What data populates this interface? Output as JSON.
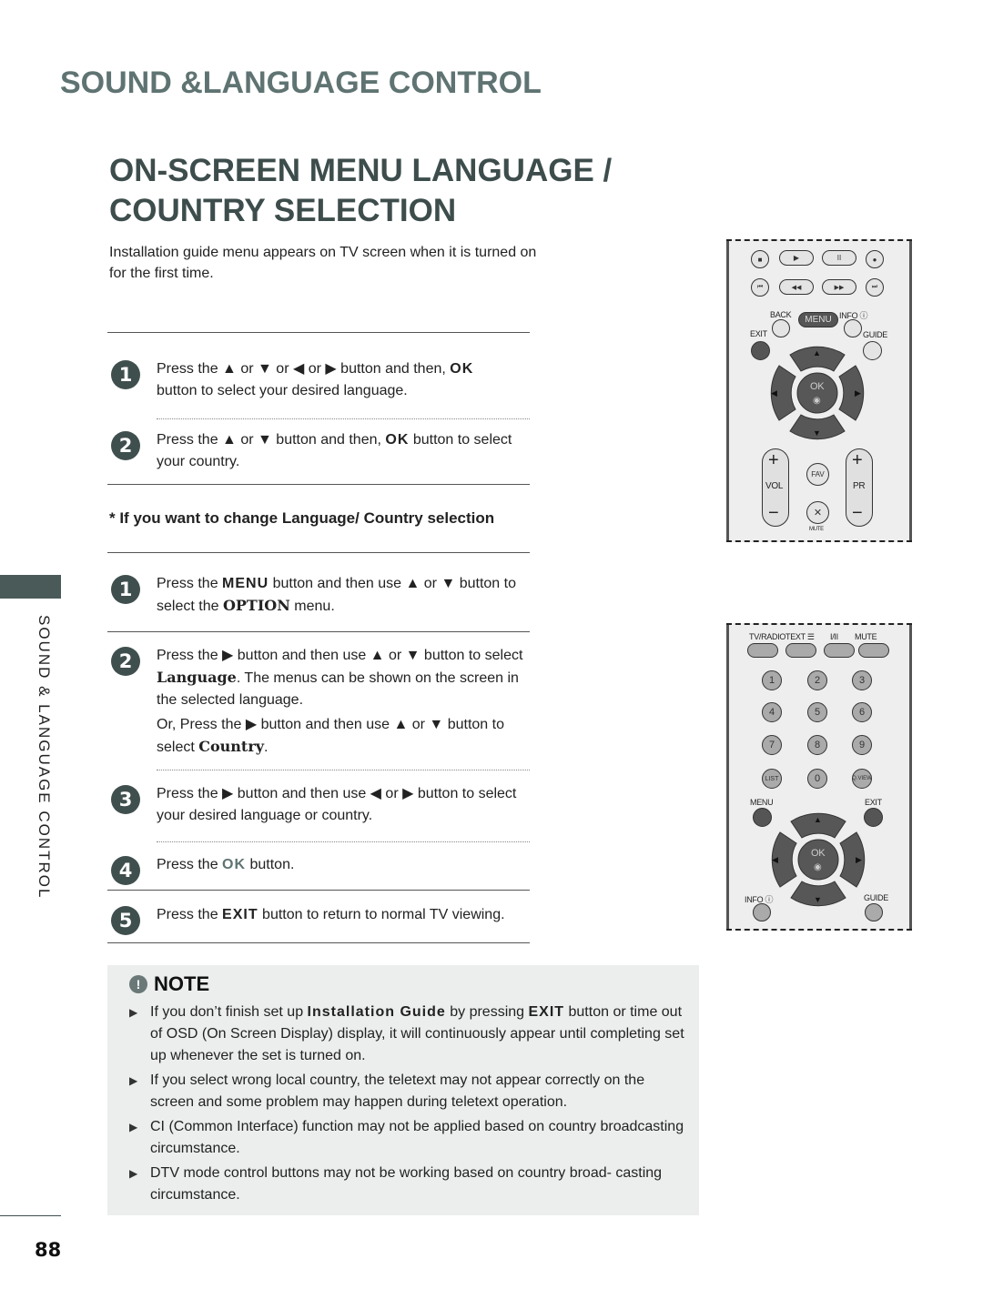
{
  "header": {
    "section_title": "SOUND &LANGUAGE CONTROL",
    "page_title_line1": "ON-SCREEN MENU LANGUAGE /",
    "page_title_line2": "COUNTRY SELECTION",
    "intro": "Installation guide menu appears on TV screen when it is turned on for the first time."
  },
  "first_time_steps": [
    {
      "num": "1",
      "parts": [
        "Press the ",
        "▲",
        " or ",
        "▼",
        " or ",
        "◀",
        " or ",
        "▶",
        " button and then, ",
        "OK",
        " button to select your desired language."
      ]
    },
    {
      "num": "2",
      "parts": [
        "Press the ",
        "▲",
        " or ",
        "▼",
        " button and then, ",
        "OK",
        " button to select your country."
      ]
    }
  ],
  "subheading": "* If you want to change Language/ Country selection",
  "change_steps": [
    {
      "num": "1",
      "a": "Press the ",
      "menu": "MENU",
      "b": " button and then use ▲ or ▼ button to select the ",
      "option": "OPTION",
      "c": " menu."
    },
    {
      "num": "2",
      "a": "Press the ▶ button and then use ▲ or ▼ button to select ",
      "language": "Language",
      "b": ". The menus can be shown on the screen in the selected language.",
      "c": "Or, Press the ▶ button and then use ▲ or ▼ button to select ",
      "country": "Country",
      "d": "."
    },
    {
      "num": "3",
      "text": "Press the ▶ button and then use ◀ or ▶ button to select your desired language or country."
    },
    {
      "num": "4",
      "a": "Press the ",
      "ok": "OK",
      "b": " button."
    },
    {
      "num": "5",
      "a": "Press the ",
      "exit": "EXIT",
      "b": " button to return to normal TV viewing."
    }
  ],
  "note": {
    "title": "NOTE",
    "icon": "exclamation-icon",
    "items": [
      {
        "a": "If you don’t finish set up ",
        "bold1": "Installation Guide",
        "b": " by pressing ",
        "bold2": "EXIT",
        "c": " button or time out of OSD (On Screen Display) display, it will continuously appear until completing set up whenever the set is turned on."
      },
      {
        "a": "If you select wrong local country, the teletext may not appear correctly on the screen and some problem may happen during teletext operation."
      },
      {
        "a": "CI (Common Interface) function may not be applied based on country broadcasting circumstance."
      },
      {
        "a": "DTV mode control buttons may not be working based on country broad- casting circumstance."
      }
    ]
  },
  "sidebar": {
    "label": "SOUND & LANGUAGE CONTROL"
  },
  "page_number": "88",
  "remote1": {
    "back": "BACK",
    "menu": "MENU",
    "info": "INFO ⓘ",
    "exit": "EXIT",
    "guide": "GUIDE",
    "ok": "OK",
    "vol": "VOL",
    "pr": "PR",
    "fav": "FAV",
    "mute": "MUTE",
    "plus": "+",
    "minus": "−",
    "stop": "■",
    "play": "▶",
    "pause": "II",
    "rec": "●",
    "prev": "⏮",
    "rew": "◀◀",
    "ff": "▶▶",
    "next": "⏭",
    "up": "▲",
    "down": "▼",
    "left": "◀",
    "right": "▶"
  },
  "remote2": {
    "tvradio": "TV/RADIO",
    "text": "TEXT ☰",
    "dual": "I/II",
    "mute": "MUTE",
    "digits": [
      "1",
      "2",
      "3",
      "4",
      "5",
      "6",
      "7",
      "8",
      "9"
    ],
    "list": "LIST",
    "zero": "0",
    "qview": "Q.VIEW",
    "menu": "MENU",
    "exit": "EXIT",
    "info": "INFO ⓘ",
    "guide": "GUIDE",
    "ok": "OK",
    "up": "▲",
    "down": "▼",
    "left": "◀",
    "right": "▶"
  }
}
